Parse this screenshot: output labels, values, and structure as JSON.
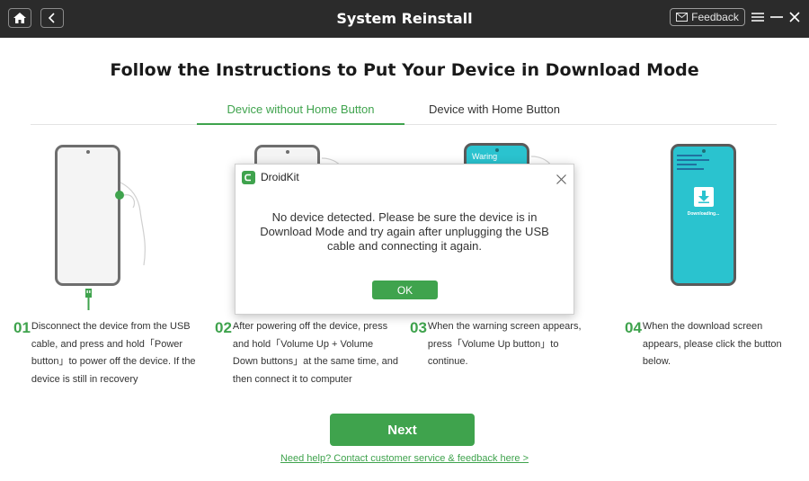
{
  "titlebar": {
    "title": "System Reinstall",
    "feedback_label": "Feedback"
  },
  "heading": "Follow the Instructions to Put Your Device in Download Mode",
  "tabs": [
    {
      "label": "Device without Home Button",
      "active": true
    },
    {
      "label": "Device with Home Button",
      "active": false
    }
  ],
  "phones": {
    "phone3_label": "Waring",
    "phone4_label": "Downloading..."
  },
  "steps": [
    {
      "num": "01",
      "text": "Disconnect the device from the USB cable, and press and hold「Power button」to power off the device. If the device is still in recovery"
    },
    {
      "num": "02",
      "text": "After powering off the device, press and hold「Volume Up + Volume Down buttons」at the same time, and then connect it to computer"
    },
    {
      "num": "03",
      "text": "When the warning screen appears, press「Volume Up button」to continue."
    },
    {
      "num": "04",
      "text": "When the download screen appears, please click the button below."
    }
  ],
  "next_label": "Next",
  "help_link": "Need help? Contact customer service & feedback here >",
  "dialog": {
    "app_name": "DroidKit",
    "message": "No device detected. Please be sure the device is in Download Mode and try again after unplugging the USB cable and connecting it again.",
    "ok_label": "OK"
  },
  "colors": {
    "accent": "#3fa34d",
    "titlebar": "#2b2b2b",
    "screen": "#2ac3cf"
  },
  "icons": [
    "home-icon",
    "back-icon",
    "mail-icon",
    "menu-icon",
    "minimize-icon",
    "close-icon",
    "usb-cable-icon",
    "download-arrow-icon",
    "droidkit-logo-icon"
  ]
}
